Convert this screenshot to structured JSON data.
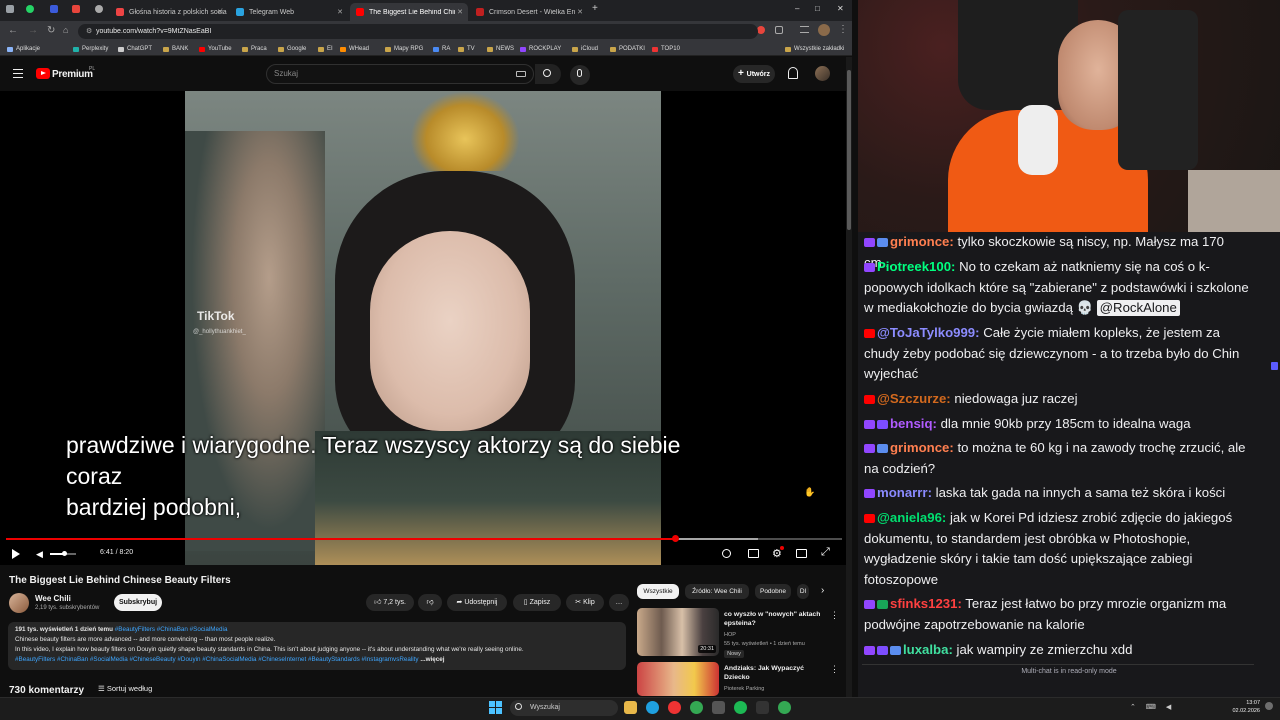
{
  "browser": {
    "tabs": [
      {
        "label": "Głośna historia z polskich socia",
        "color": "#e44"
      },
      {
        "label": "Telegram Web",
        "color": "#2aa3e0"
      },
      {
        "label": "The Biggest Lie Behind Chinese",
        "color": "#ff0000"
      },
      {
        "label": "Crimson Desert - Wielka Encyk",
        "color": "#c02020"
      }
    ],
    "new_tab": "+",
    "url": "youtube.com/watch?v=9MtZNasEaBI",
    "bookmarks": [
      "Aplikacje",
      "Perplexity",
      "ChatGPT",
      "BANK",
      "YouTube",
      "Praca",
      "Google",
      "EI",
      "WHead",
      "Mapy RPG",
      "RA",
      "TV",
      "NEWS",
      "ROCKPLAY",
      "iCloud",
      "PODATKI",
      "TOP10"
    ],
    "bookmarks_all": "Wszystkie zakładki",
    "window_controls": [
      "–",
      "□",
      "✕"
    ]
  },
  "youtube": {
    "logo": "Premium",
    "logo_region": "PL",
    "search_placeholder": "Szukaj",
    "create_label": "Utwórz",
    "video": {
      "watermark": "TikTok",
      "watermark_handle": "@_hollythuankhiet_",
      "subtitle_lines": [
        "prawdziwe i wiarygodne.  Teraz wszyscy aktorzy są do siebie",
        "coraz",
        "bardziej podobni,"
      ],
      "time": "6:41 / 8:20",
      "progress": 0.8,
      "buffered": 0.9
    },
    "title": "The Biggest Lie Behind Chinese Beauty Filters",
    "channel": {
      "name": "Wee Chili",
      "subs": "2,19 tys. subskrybentów",
      "subscribe": "Subskrybuj"
    },
    "actions": {
      "likes": "7,2 tys.",
      "share": "Udostępnij",
      "save": "Zapisz",
      "clip": "Klip",
      "more": "…"
    },
    "description": {
      "stats": "191 tys. wyświetleń  1 dzień temu",
      "stats_tags": "#BeautyFilters #ChinaBan #SocialMedia",
      "line1": "Chinese beauty filters are more advanced -- and more convincing -- than most people realize.",
      "line2": "In this video, I explain how beauty filters on Douyin quietly shape beauty standards in China. This isn't about judging anyone -- it's about understanding what we're really seeing online.",
      "tags": "#BeautyFilters #ChinaBan #SocialMedia #ChineseBeauty #Douyin #ChinaSocialMedia #ChineseInternet  #BeautyStandards #InstagramvsReality",
      "more": "...więcej"
    },
    "comments_count": "730 komentarzy",
    "sort_by": "Sortuj według",
    "chips": [
      "Wszystkie",
      "Źródło: Wee Chili",
      "Podobne",
      "Dl"
    ],
    "recommendations": [
      {
        "title": "co wyszło w \"nowych\" aktach epsteina?",
        "channel": "HOP",
        "meta": "55 tys. wyświetleń • 1 dzień temu",
        "badge": "Nowy",
        "duration": "20:31"
      },
      {
        "title": "Andziaks: Jak Wypaczyć Dziecko",
        "channel": "Pioterek Parking",
        "meta": "",
        "badge": "",
        "duration": ""
      }
    ]
  },
  "taskbar": {
    "search": "Wyszukaj",
    "time": "13:07",
    "date": "02.02.2026"
  },
  "chat": {
    "messages": [
      {
        "src": "tw",
        "badges": [
          "sub"
        ],
        "user": "grimonce",
        "color": "#ff7f50",
        "text": "tylko skoczkowie są niscy, np. Małysz ma 170 cm..."
      },
      {
        "src": "tw",
        "badges": [],
        "user": "Piotreek100",
        "color": "#00ff7f",
        "text": "No to czekam aż natkniemy się na coś o k-popowych idolkach które są \"zabierane\" z podstawówki i szkolone w mediakołchozie do bycia gwiazdą 💀 ",
        "mention": "@RockAlone"
      },
      {
        "src": "yt",
        "badges": [],
        "user": "@ToJaTylko999",
        "color": "#8c8cff",
        "text": "Całe życie miałem kopleks, że jestem za chudy żeby podobać się dziewczynom - a to trzeba było do Chin wyjechać"
      },
      {
        "src": "yt",
        "badges": [],
        "user": "@Szczurze",
        "color": "#d2691e",
        "text": "niedowaga juz raczej"
      },
      {
        "src": "tw",
        "badges": [
          "pr"
        ],
        "user": "bensiq",
        "color": "#b05bff",
        "text": "dla mnie 90kb przy 185cm to idealna waga"
      },
      {
        "src": "tw",
        "badges": [
          "sub"
        ],
        "user": "grimonce",
        "color": "#ff7f50",
        "text": "to można te 60 kg i na zawody trochę zrzucić, ale na codzień?"
      },
      {
        "src": "tw",
        "badges": [],
        "user": "monarrr",
        "color": "#8a8aff",
        "text": "laska tak gada na innych a sama też skóra i kości"
      },
      {
        "src": "yt",
        "badges": [],
        "user": "@aniela96",
        "color": "#00e070",
        "text": "jak w Korei Pd idziesz zrobić zdjęcie do jakiegoś dokumentu, to standardem jest obróbka w Photoshopie, wygładzenie skóry i takie tam dość upiększające zabiegi fotoszopowe"
      },
      {
        "src": "tw",
        "badges": [
          "mod"
        ],
        "user": "sfinks1231",
        "color": "#ff4040",
        "text": "Teraz jest łatwo bo przy mrozie organizm ma podwójne zapotrzebowanie na kalorie"
      },
      {
        "src": "tw",
        "badges": [
          "pr",
          "sub"
        ],
        "user": "luxalba",
        "color": "#40e0a0",
        "text": "jak wampiry ze zmierzchu xdd"
      }
    ],
    "readonly": "Multi-chat is in read-only mode"
  }
}
